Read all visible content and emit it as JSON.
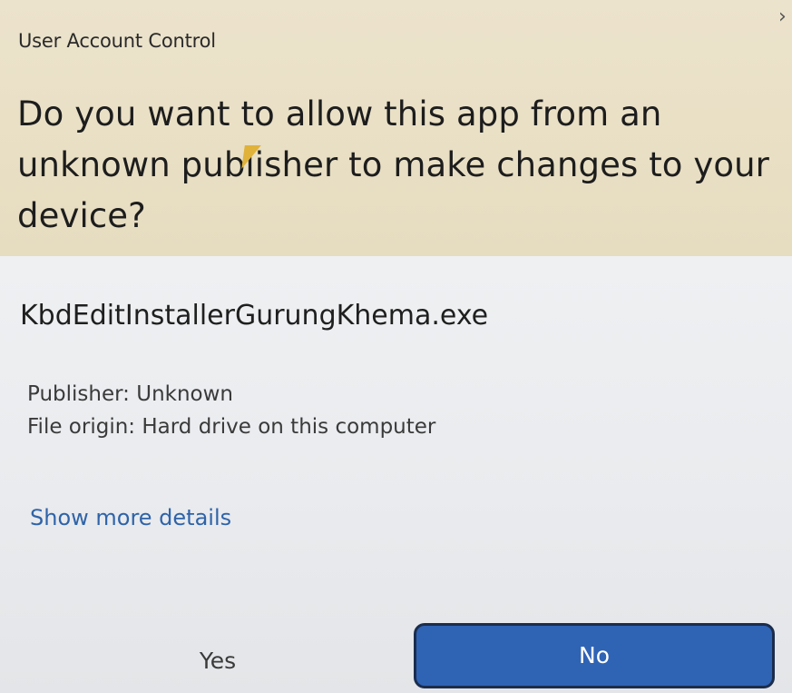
{
  "window": {
    "title": "User Account Control",
    "close_glyph": "›"
  },
  "prompt": {
    "question": "Do you want to allow this app from an unknown publisher to make changes to your device?"
  },
  "app": {
    "file_name": "KbdEditInstallerGurungKhema.exe",
    "publisher_line": "Publisher: Unknown",
    "origin_line": "File origin: Hard drive on this computer"
  },
  "links": {
    "show_more_details": "Show more details"
  },
  "buttons": {
    "yes": "Yes",
    "no": "No"
  },
  "colors": {
    "header_bg": "#e9dfc4",
    "body_bg": "#eceef0",
    "link": "#2f63a8",
    "primary_button": "#2f63b4"
  }
}
